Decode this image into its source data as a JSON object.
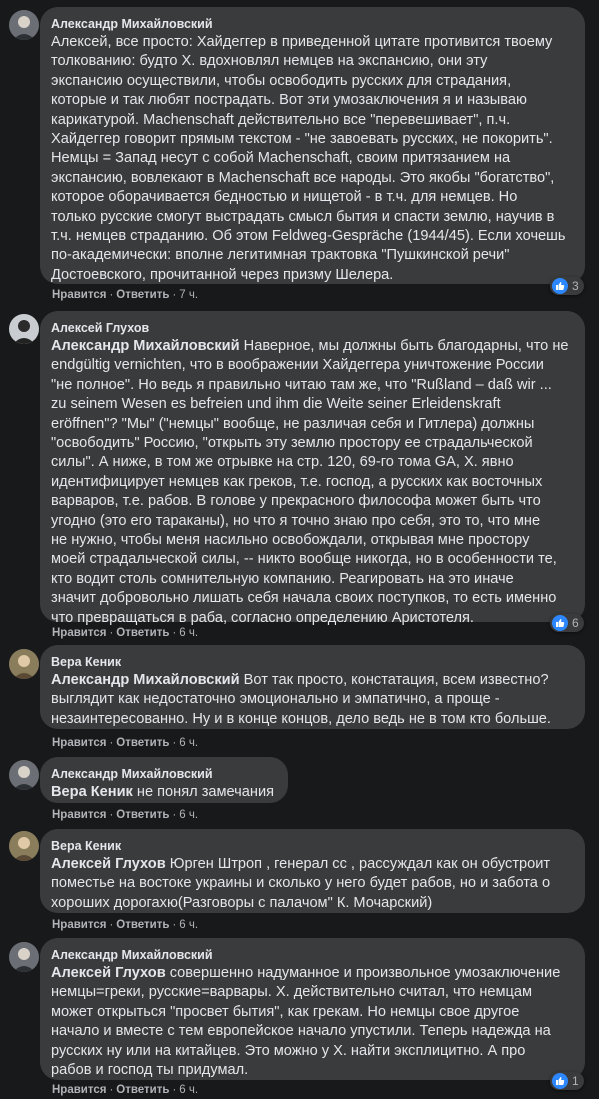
{
  "comments": [
    {
      "author": "Александр Михайловский",
      "mention": "",
      "text": "Алексей, все просто: Хайдеггер в приведенной цитате противится твоему\nтолкованию: будто Х. вдохновлял немцев на экспансию, они эту\nэкспансию осуществили, чтобы освободить русских для страдания,\nкоторые и так любят пострадать. Вот эти умозаключения я и называю\nкарикатурой. Machenschaft действительно все \"перевешивает\", п.ч.\nХайдеггер говорит прямым текстом - \"не завоевать русских, не покорить\".\nНемцы = Запад несут с собой Machenschaft, своим притязанием на\nэкспансию, вовлекают в Machenschaft все народы. Это якобы \"богатство\",\nкоторое оборачивается бедностью и нищетой - в т.ч. для немцев. Но\nтолько русские смогут выстрадать смысл бытия и спасти землю, научив в\nт.ч. немцев страданию. Об этом Feldweg-Gespräche (1944/45). Если хочешь\nпо-академически: вполне легитимная трактовка \"Пушкинской речи\"\nДостоевского, прочитанной через призму Шелера.",
      "like": "Нравится",
      "reply": "Ответить",
      "time": "7 ч.",
      "reactions": "3"
    },
    {
      "author": "Алексей Глухов",
      "mention": "Александр Михайловский",
      "text": " Наверное, мы должны быть благодарны, что не\nendgültig vernichten, что в воображении Хайдеггера уничтожение России\n\"не полное\". Но ведь я правильно читаю там же, что \"Rußland – daß wir ...\nzu seinem Wesen es befreien und ihm die Weite seiner Erleidenskraft\neröffnen\"? \"Мы\" (\"немцы\" вообще, не различая себя и Гитлера) должны\n\"освободить\" Россию, \"открыть эту землю простору ее страдальческой\nсилы\". А ниже, в том же отрывке на стр. 120, 69-го тома GA, Х. явно\nидентифицирует немцев как греков, т.е. господ, а русских как восточных\nварваров, т.е. рабов. В голове у прекрасного философа может быть что\nугодно (это его тараканы), но что я точно знаю про себя, это то, что мне\nне нужно, чтобы меня насильно освобождали, открывая мне простору\nмоей страдальческой силы, -- никто вообще никогда, но в особенности те,\nкто водит столь сомнительную компанию. Реагировать на это иначе\nзначит добровольно лишать себя начала своих поступков, то есть именно\nчто превращаться в раба, согласно определению Аристотеля.",
      "like": "Нравится",
      "reply": "Ответить",
      "time": "6 ч.",
      "reactions": "6"
    },
    {
      "author": "Вера Кеник",
      "mention": "Александр Михайловский",
      "text": " Вот так просто, констатация, всем известно?\nвыглядит как недостаточно эмоционально и эмпатично, а проще -\nнезаинтересованно. Ну и в конце концов, дело ведь не в том кто больше.",
      "like": "Нравится",
      "reply": "Ответить",
      "time": "6 ч.",
      "reactions": ""
    },
    {
      "author": "Александр Михайловский",
      "mention": "Вера Кеник",
      "text": " не понял замечания",
      "like": "Нравится",
      "reply": "Ответить",
      "time": "6 ч.",
      "reactions": ""
    },
    {
      "author": "Вера Кеник",
      "mention": "Алексей Глухов",
      "text": " Юрген Штроп , генерал сс , рассуждал как он обустроит\nпоместье на востоке украины и сколько у него будет рабов, но и забота о\nхороших дорогахю(Разговоры с палачом\" К. Мочарский)",
      "like": "Нравится",
      "reply": "Ответить",
      "time": "6 ч.",
      "reactions": ""
    },
    {
      "author": "Александр Михайловский",
      "mention": "Алексей Глухов",
      "text": " совершенно надуманное и произвольное умозаключение\nнемцы=греки, русские=варвары. Х. действительно считал, что немцам\nможет открыться \"просвет бытия\", как грекам. Но немцы свое другое\nначало и вместе с тем европейское начало упустили. Теперь надежда на\nрусских ну или на китайцев. Это можно у Х. найти эксплицитно. А про\nрабов и господ ты придумал.",
      "like": "Нравится",
      "reply": "Ответить",
      "time": "6 ч.",
      "reactions": "1"
    }
  ],
  "ui": {
    "dot": "·"
  },
  "colors": {
    "background": "#18191a",
    "bubble": "#3a3b3c",
    "like": "#2d88ff",
    "meta": "#b0b3b8"
  }
}
